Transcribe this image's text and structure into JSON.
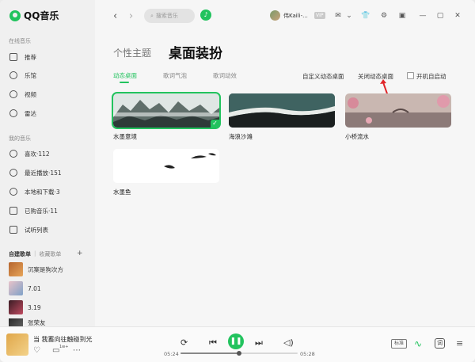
{
  "app": {
    "name": "QQ音乐"
  },
  "sidebar": {
    "online_title": "在线音乐",
    "online_items": [
      {
        "label": "推荐",
        "icon": "home-icon"
      },
      {
        "label": "乐馆",
        "icon": "compass-icon"
      },
      {
        "label": "视频",
        "icon": "play-circle-icon"
      },
      {
        "label": "雷达",
        "icon": "radar-icon"
      }
    ],
    "mine_title": "我的音乐",
    "mine_items": [
      {
        "label": "喜欢·112",
        "icon": "heart-icon"
      },
      {
        "label": "最近播放·151",
        "icon": "clock-icon"
      },
      {
        "label": "本地和下载·3",
        "icon": "download-icon"
      },
      {
        "label": "已购音乐·11",
        "icon": "bag-icon"
      },
      {
        "label": "试听列表",
        "icon": "list-icon"
      }
    ],
    "playlist_tabs": [
      "自建歌单",
      "收藏歌单"
    ],
    "playlists": [
      {
        "label": "沉案是狗次方"
      },
      {
        "label": "7.01"
      },
      {
        "label": "3.19"
      },
      {
        "label": "张荣友"
      }
    ]
  },
  "topbar": {
    "search_placeholder": "搜索音乐",
    "username": "伟Kaili-...",
    "vip_label": "VIP"
  },
  "page": {
    "subtitle": "个性主题",
    "title": "桌面装扮",
    "tabs": [
      "动态桌面",
      "歌词气泡",
      "歌词动效"
    ],
    "active_tab": 0,
    "actions": {
      "custom": "自定义动态桌面",
      "close": "关闭动态桌面",
      "autostart": "开机自启动"
    },
    "cards": [
      {
        "label": "水墨意境",
        "selected": true
      },
      {
        "label": "海浪沙滩",
        "selected": false
      },
      {
        "label": "小桥流水",
        "selected": false
      },
      {
        "label": "水墨鱼",
        "selected": false
      }
    ]
  },
  "player": {
    "song": "当 我蓄向往触碰到光",
    "elapsed": "05:24",
    "duration": "05:28",
    "progress": 0.5,
    "quality_label": "标准",
    "lyric_label": "词",
    "comment_count": "1w+"
  },
  "colors": {
    "accent": "#22c35e"
  }
}
